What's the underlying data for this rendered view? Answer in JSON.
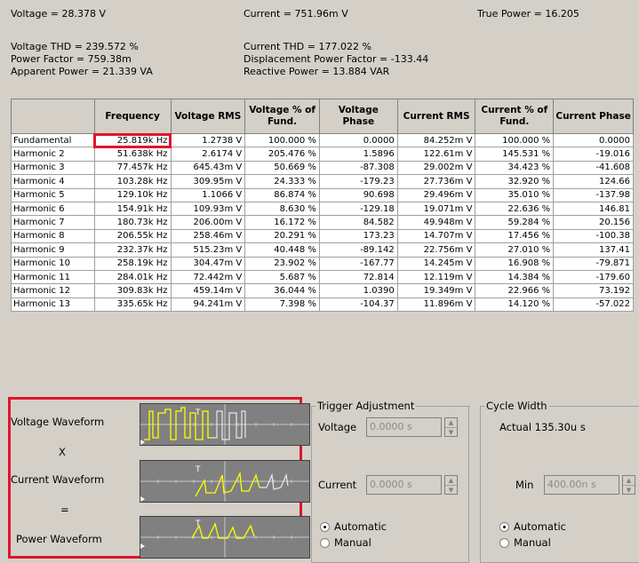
{
  "summary": {
    "voltage": "Voltage = 28.378 V",
    "current": "Current = 751.96m V",
    "true_power": "True Power = 16.205",
    "voltage_thd": "Voltage THD = 239.572 %",
    "current_thd": "Current THD = 177.022 %",
    "power_factor": "Power Factor = 759.38m",
    "displacement_pf": "Displacement Power Factor = -133.44",
    "apparent_power": "Apparent Power = 21.339 VA",
    "reactive_power": "Reactive Power = 13.884 VAR"
  },
  "table": {
    "headers": [
      "",
      "Frequency",
      "Voltage RMS",
      "Voltage % of Fund.",
      "Voltage Phase",
      "Current RMS",
      "Current % of Fund.",
      "Current Phase"
    ],
    "rows": [
      [
        "Fundamental",
        "25.819k Hz",
        "1.2738 V",
        "100.000 %",
        "0.0000",
        "84.252m V",
        "100.000 %",
        "0.0000"
      ],
      [
        "Harmonic 2",
        "51.638k Hz",
        "2.6174 V",
        "205.476 %",
        "1.5896",
        "122.61m V",
        "145.531 %",
        "-19.016"
      ],
      [
        "Harmonic 3",
        "77.457k Hz",
        "645.43m V",
        "50.669 %",
        "-87.308",
        "29.002m V",
        "34.423 %",
        "-41.608"
      ],
      [
        "Harmonic 4",
        "103.28k Hz",
        "309.95m V",
        "24.333 %",
        "-179.23",
        "27.736m V",
        "32.920 %",
        "124.66"
      ],
      [
        "Harmonic 5",
        "129.10k Hz",
        "1.1066 V",
        "86.874 %",
        "90.698",
        "29.496m V",
        "35.010 %",
        "-137.98"
      ],
      [
        "Harmonic 6",
        "154.91k Hz",
        "109.93m V",
        "8.630 %",
        "-129.18",
        "19.071m V",
        "22.636 %",
        "146.81"
      ],
      [
        "Harmonic 7",
        "180.73k Hz",
        "206.00m V",
        "16.172 %",
        "84.582",
        "49.948m V",
        "59.284 %",
        "20.156"
      ],
      [
        "Harmonic 8",
        "206.55k Hz",
        "258.46m V",
        "20.291 %",
        "173.23",
        "14.707m V",
        "17.456 %",
        "-100.38"
      ],
      [
        "Harmonic 9",
        "232.37k Hz",
        "515.23m V",
        "40.448 %",
        "-89.142",
        "22.756m V",
        "27.010 %",
        "137.41"
      ],
      [
        "Harmonic 10",
        "258.19k Hz",
        "304.47m V",
        "23.902 %",
        "-167.77",
        "14.245m V",
        "16.908 %",
        "-79.871"
      ],
      [
        "Harmonic 11",
        "284.01k Hz",
        "72.442m V",
        "5.687 %",
        "72.814",
        "12.119m V",
        "14.384 %",
        "-179.60"
      ],
      [
        "Harmonic 12",
        "309.83k Hz",
        "459.14m V",
        "36.044 %",
        "1.0390",
        "19.349m V",
        "22.966 %",
        "73.192"
      ],
      [
        "Harmonic 13",
        "335.65k Hz",
        "94.241m V",
        "7.398 %",
        "-104.37",
        "11.896m V",
        "14.120 %",
        "-57.022"
      ]
    ]
  },
  "waveforms": {
    "voltage_label": "Voltage Waveform",
    "x_label": "X",
    "current_label": "Current Waveform",
    "eq_label": "=",
    "power_label": "Power Waveform",
    "trigger_marker": "T",
    "trace_color": "#ffff00",
    "highlight_color": "#e0142c"
  },
  "trigger": {
    "title": "Trigger Adjustment",
    "voltage_label": "Voltage",
    "voltage_value": "0.0000 s",
    "current_label": "Current",
    "current_value": "0.0000 s",
    "automatic": "Automatic",
    "manual": "Manual",
    "selected": "Automatic"
  },
  "cycle": {
    "title": "Cycle Width",
    "actual": "Actual  135.30u s",
    "min_label": "Min",
    "min_value": "400.00n s",
    "automatic": "Automatic",
    "manual": "Manual",
    "selected": "Automatic"
  }
}
